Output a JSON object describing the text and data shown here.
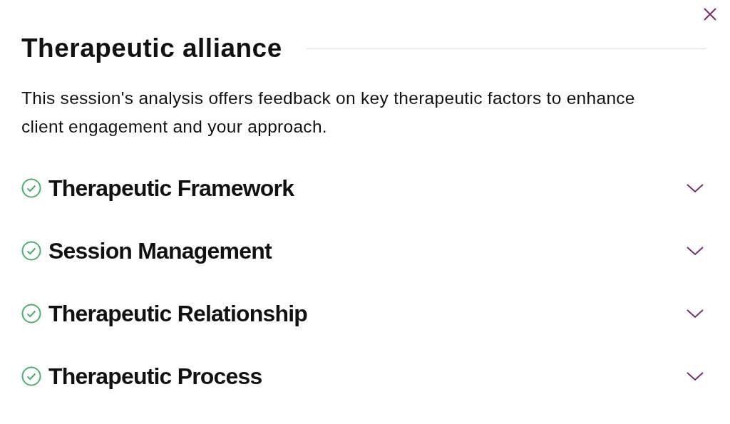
{
  "title": "Therapeutic alliance",
  "description": "This session's analysis offers feedback on key therapeutic factors to enhance client engagement and your approach.",
  "sections": [
    {
      "title": "Therapeutic Framework",
      "expanded": false,
      "complete": true
    },
    {
      "title": "Session Management",
      "expanded": false,
      "complete": true
    },
    {
      "title": "Therapeutic Relationship",
      "expanded": false,
      "complete": true
    },
    {
      "title": "Therapeutic Process",
      "expanded": false,
      "complete": true
    }
  ]
}
